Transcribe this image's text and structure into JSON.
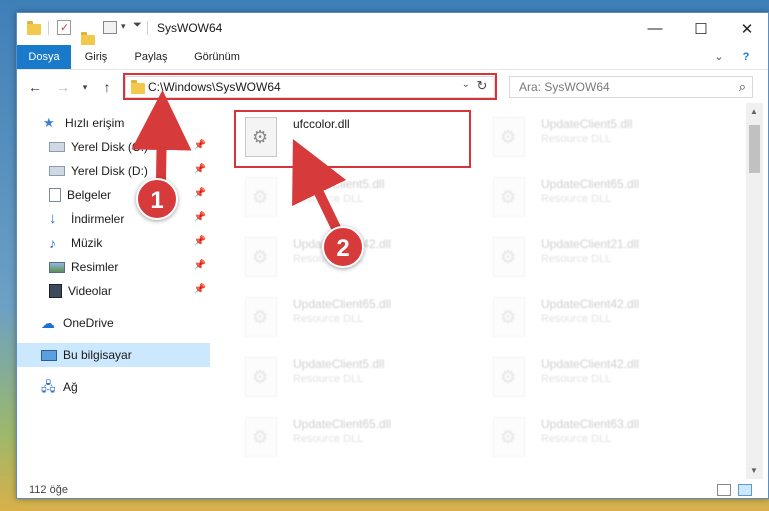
{
  "window": {
    "title": "SysWOW64",
    "controls": {
      "minimize": "—",
      "maximize": "☐",
      "close": "✕"
    }
  },
  "ribbon": {
    "tabs": [
      {
        "label": "Dosya",
        "active": true
      },
      {
        "label": "Giriş",
        "active": false
      },
      {
        "label": "Paylaş",
        "active": false
      },
      {
        "label": "Görünüm",
        "active": false
      }
    ],
    "help": "?"
  },
  "address": {
    "path": "C:\\Windows\\SysWOW64",
    "refresh": "↻",
    "dropdown": "⌄"
  },
  "search": {
    "placeholder": "Ara: SysWOW64"
  },
  "sidebar": {
    "items": [
      {
        "label": "Hızlı erişim",
        "icon": "star-icon"
      },
      {
        "label": "Yerel Disk (C:)",
        "icon": "drive-icon",
        "pinned": true
      },
      {
        "label": "Yerel Disk (D:)",
        "icon": "drive-icon",
        "pinned": true
      },
      {
        "label": "Belgeler",
        "icon": "documents-icon",
        "pinned": true
      },
      {
        "label": "İndirmeler",
        "icon": "download-icon",
        "pinned": true
      },
      {
        "label": "Müzik",
        "icon": "music-icon",
        "pinned": true
      },
      {
        "label": "Resimler",
        "icon": "pictures-icon",
        "pinned": true
      },
      {
        "label": "Videolar",
        "icon": "videos-icon",
        "pinned": true
      },
      {
        "label": "OneDrive",
        "icon": "cloud-icon"
      },
      {
        "label": "Bu bilgisayar",
        "icon": "computer-icon",
        "selected": true
      },
      {
        "label": "Ağ",
        "icon": "network-icon"
      }
    ],
    "pin_glyph": "📌"
  },
  "files": [
    {
      "name": "ufccolor.dll",
      "type": "",
      "highlighted": true
    },
    {
      "name": "UpdateClient5.dll",
      "type": "Resource DLL"
    },
    {
      "name": "UpdateClient5.dll",
      "type": "Resource DLL"
    },
    {
      "name": "UpdateClient65.dll",
      "type": "Resource DLL"
    },
    {
      "name": "UpdateClient42.dll",
      "type": "Resource DLL"
    },
    {
      "name": "UpdateClient21.dll",
      "type": "Resource DLL"
    },
    {
      "name": "UpdateClient65.dll",
      "type": "Resource DLL"
    },
    {
      "name": "UpdateClient42.dll",
      "type": "Resource DLL"
    },
    {
      "name": "UpdateClient5.dll",
      "type": "Resource DLL"
    },
    {
      "name": "UpdateClient42.dll",
      "type": "Resource DLL"
    },
    {
      "name": "UpdateClient65.dll",
      "type": "Resource DLL"
    },
    {
      "name": "UpdateClient63.dll",
      "type": "Resource DLL"
    }
  ],
  "status": {
    "item_count": "112 öğe"
  },
  "callouts": {
    "step1": "1",
    "step2": "2"
  },
  "colors": {
    "accent": "#1979ca",
    "callout": "#d63a3a",
    "selected": "#cce8ff"
  }
}
